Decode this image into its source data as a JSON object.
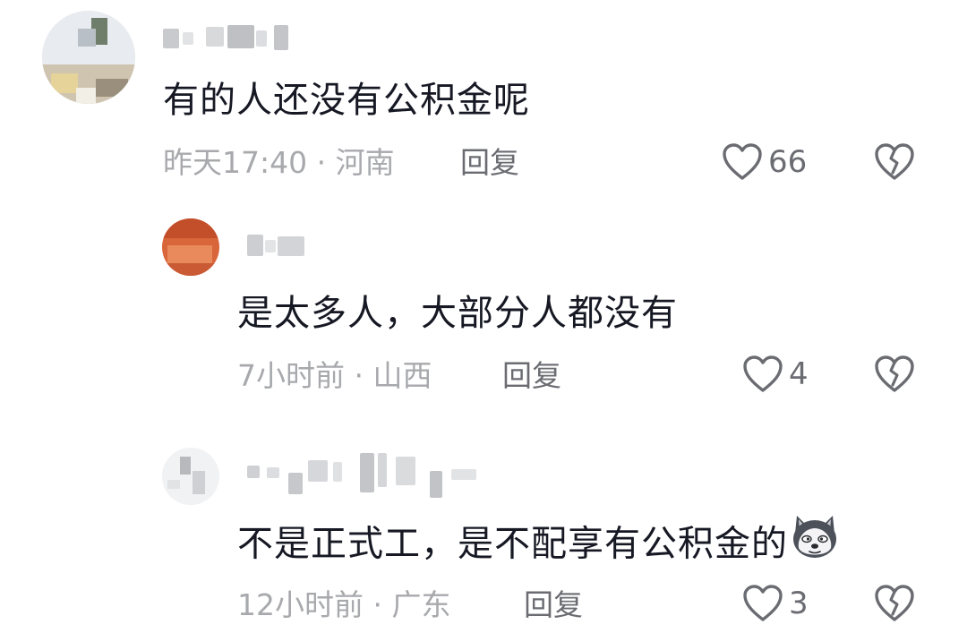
{
  "comments": [
    {
      "text": "有的人还没有公积金呢",
      "time": "昨天17:40",
      "location": "河南",
      "reply_label": "回复",
      "likes": "66"
    },
    {
      "text": "是太多人，大部分人都没有",
      "time": "7小时前",
      "location": "山西",
      "reply_label": "回复",
      "likes": "4"
    },
    {
      "text": "不是正式工，是不配享有公积金的",
      "time": "12小时前",
      "location": "广东",
      "reply_label": "回复",
      "likes": "3",
      "emoji": "husky-dog-emoji"
    }
  ],
  "separator": " · ",
  "colors": {
    "text": "#161823",
    "meta": "#a8a9ad",
    "action": "#6b6c72",
    "background": "#ffffff"
  },
  "icons": [
    "heart-icon",
    "broken-heart-icon"
  ]
}
